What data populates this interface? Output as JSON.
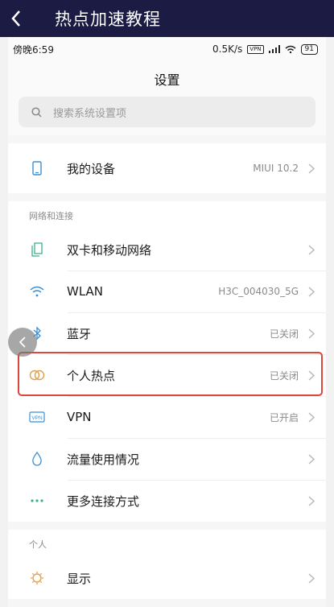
{
  "app_bar": {
    "title": "热点加速教程",
    "back_icon": "chevron-left-icon"
  },
  "status_bar": {
    "time": "傍晚6:59",
    "speed": "0.5K/s",
    "vpn": "VPN",
    "battery": "91"
  },
  "settings": {
    "title": "设置",
    "search_placeholder": "搜索系统设置项",
    "device": {
      "label": "我的设备",
      "value": "MIUI 10.2",
      "icon": "phone-icon"
    },
    "network_section": {
      "title": "网络和连接",
      "items": [
        {
          "label": "双卡和移动网络",
          "value": "",
          "icon": "sim-card-icon"
        },
        {
          "label": "WLAN",
          "value": "H3C_004030_5G",
          "icon": "wifi-icon"
        },
        {
          "label": "蓝牙",
          "value": "已关闭",
          "icon": "bluetooth-icon"
        },
        {
          "label": "个人热点",
          "value": "已关闭",
          "icon": "hotspot-icon"
        },
        {
          "label": "VPN",
          "value": "已开启",
          "icon": "vpn-icon"
        },
        {
          "label": "流量使用情况",
          "value": "",
          "icon": "data-drop-icon"
        },
        {
          "label": "更多连接方式",
          "value": "",
          "icon": "more-dots-icon"
        }
      ]
    },
    "personal_section": {
      "title": "个人",
      "items": [
        {
          "label": "显示",
          "value": "",
          "icon": "brightness-icon"
        }
      ]
    }
  },
  "colors": {
    "app_bar": "#1b1b44",
    "highlight": "#d9483b",
    "icon_blue": "#3a8fd6"
  }
}
